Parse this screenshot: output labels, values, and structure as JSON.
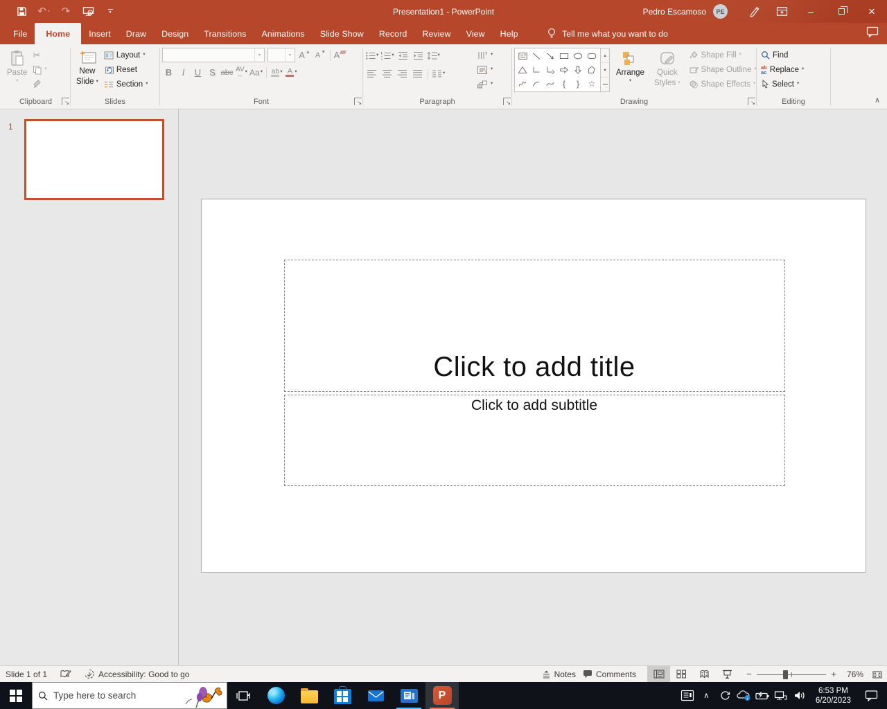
{
  "icons": {
    "dropdown": "▾",
    "undo": "↶",
    "redo": "↷",
    "cut": "✂",
    "collapse_ribbon": "∧",
    "tray_chevron": "∧",
    "minimize": "–",
    "close": "×",
    "zoom_out": "−",
    "zoom_in": "+",
    "scroll_up": "▴",
    "scroll_down": "▾",
    "bold": "B",
    "italic": "I",
    "underline": "U",
    "text_shadow": "S",
    "strikethrough": "abc",
    "char_spacing": "AV",
    "change_case": "Aa",
    "highlight": "ab",
    "font_color": "A",
    "grow_font": "A",
    "shrink_font": "A",
    "clear_formatting": "A",
    "brace_left": "{",
    "brace_right": "}",
    "star": "☆",
    "replace_top": "ab",
    "replace_bottom": "ac"
  },
  "titlebar": {
    "title": "Presentation1  -  PowerPoint",
    "user_name": "Pedro Escamoso",
    "user_initials": "PE"
  },
  "tabs": [
    {
      "label": "File"
    },
    {
      "label": "Home",
      "selected": true
    },
    {
      "label": "Insert"
    },
    {
      "label": "Draw"
    },
    {
      "label": "Design"
    },
    {
      "label": "Transitions"
    },
    {
      "label": "Animations"
    },
    {
      "label": "Slide Show"
    },
    {
      "label": "Record"
    },
    {
      "label": "Review"
    },
    {
      "label": "View"
    },
    {
      "label": "Help"
    }
  ],
  "tellme_label": "Tell me what you want to do",
  "ribbon": {
    "clipboard": {
      "label": "Clipboard",
      "paste": "Paste"
    },
    "slides": {
      "label": "Slides",
      "new_slide_line1": "New",
      "new_slide_line2": "Slide",
      "layout": "Layout",
      "reset": "Reset",
      "section": "Section"
    },
    "font": {
      "label": "Font"
    },
    "paragraph": {
      "label": "Paragraph"
    },
    "drawing": {
      "label": "Drawing",
      "arrange": "Arrange",
      "quick_line1": "Quick",
      "quick_line2": "Styles",
      "shape_fill": "Shape Fill",
      "shape_outline": "Shape Outline",
      "shape_effects": "Shape Effects"
    },
    "editing": {
      "label": "Editing",
      "find": "Find",
      "replace": "Replace",
      "select": "Select"
    }
  },
  "slides_panel": {
    "slide_number": "1"
  },
  "slide": {
    "title_placeholder": "Click to add title",
    "subtitle_placeholder": "Click to add subtitle"
  },
  "statusbar": {
    "slide_info": "Slide 1 of 1",
    "accessibility": "Accessibility: Good to go",
    "notes": "Notes",
    "comments": "Comments",
    "zoom_level": "76%"
  },
  "taskbar": {
    "search_placeholder": "Type here to search",
    "time": "6:53 PM",
    "date": "6/20/2023"
  },
  "colors": {
    "brand": "#b7472a",
    "ribbon_bg": "#f3f2f1",
    "workspace_bg": "#e7e7e7",
    "taskbar_bg": "#0f1219",
    "disabled_text": "#a19f9d"
  }
}
